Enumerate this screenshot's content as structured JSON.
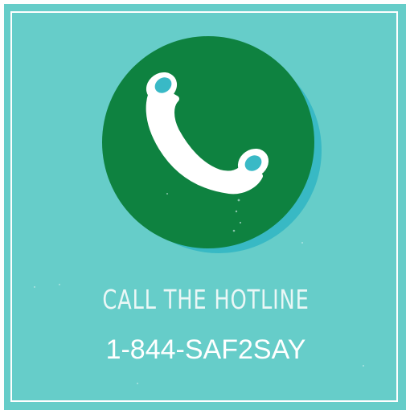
{
  "card": {
    "title": "CALL THE HOTLINE",
    "phone": "1-844-SAF2SAY",
    "icon": "phone-handset-icon"
  },
  "colors": {
    "background": "#66cdc9",
    "circle": "#0e8240",
    "circle_shadow": "#38b9c4",
    "handset": "#ffffff",
    "earpiece": "#39b9c6",
    "text": "#ffffff"
  }
}
